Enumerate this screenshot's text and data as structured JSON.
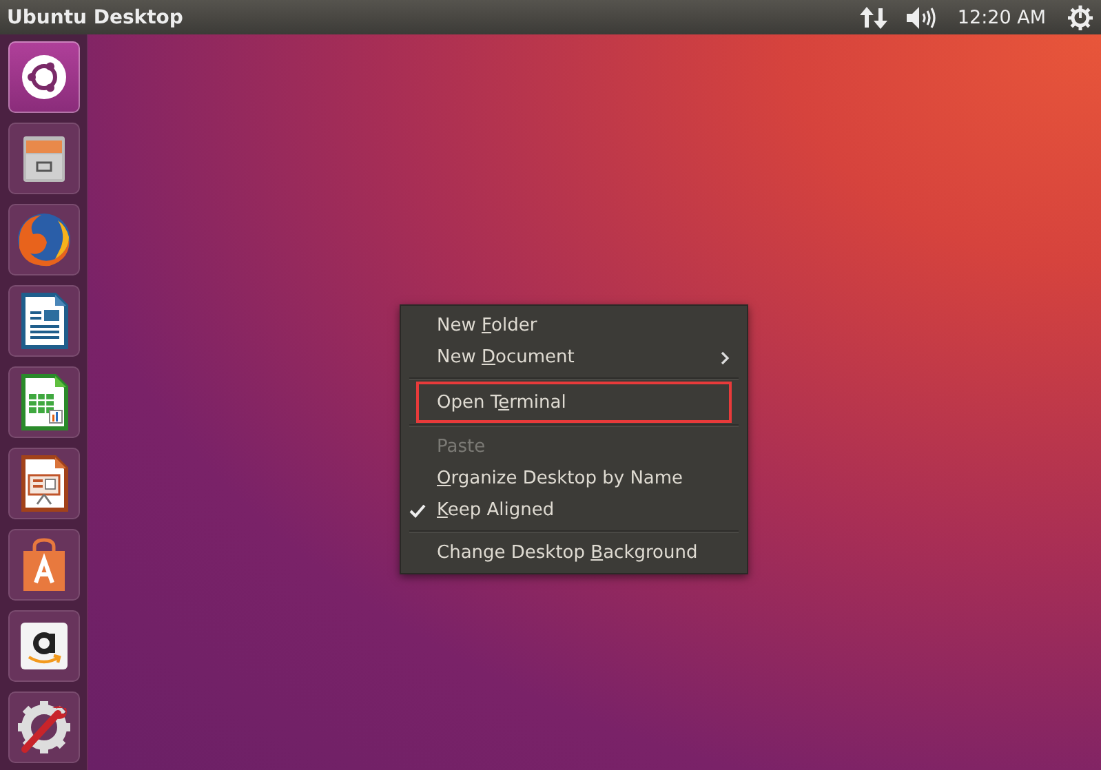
{
  "top_bar": {
    "title": "Ubuntu Desktop",
    "clock": "12:20 AM"
  },
  "launcher": [
    {
      "kind": "dash",
      "selected": true
    },
    {
      "kind": "files",
      "selected": false
    },
    {
      "kind": "browser",
      "selected": false
    },
    {
      "kind": "writer",
      "selected": false
    },
    {
      "kind": "calc",
      "selected": false
    },
    {
      "kind": "impress",
      "selected": false
    },
    {
      "kind": "store",
      "selected": false
    },
    {
      "kind": "amazon",
      "selected": false
    },
    {
      "kind": "settings",
      "selected": false
    }
  ],
  "context_menu": [
    {
      "kind": "item",
      "label": {
        "before": "New ",
        "key": "F",
        "after": "older"
      },
      "disabled": false,
      "checked": false,
      "submenu": false,
      "highlighted": false
    },
    {
      "kind": "item",
      "label": {
        "before": "New ",
        "key": "D",
        "after": "ocument"
      },
      "disabled": false,
      "checked": false,
      "submenu": true,
      "highlighted": false
    },
    {
      "kind": "separator"
    },
    {
      "kind": "item",
      "label": {
        "before": "Open T",
        "key": "e",
        "after": "rminal"
      },
      "disabled": false,
      "checked": false,
      "submenu": false,
      "highlighted": true
    },
    {
      "kind": "separator"
    },
    {
      "kind": "item",
      "label": {
        "before": "Paste"
      },
      "disabled": true,
      "checked": false,
      "submenu": false,
      "highlighted": false
    },
    {
      "kind": "item",
      "label": {
        "key": "O",
        "after": "rganize Desktop by Name"
      },
      "disabled": false,
      "checked": false,
      "submenu": false,
      "highlighted": false
    },
    {
      "kind": "item",
      "label": {
        "key": "K",
        "after": "eep Aligned"
      },
      "disabled": false,
      "checked": true,
      "submenu": false,
      "highlighted": false
    },
    {
      "kind": "separator"
    },
    {
      "kind": "item",
      "label": {
        "before": "Change Desktop ",
        "key": "B",
        "after": "ackground"
      },
      "disabled": false,
      "checked": false,
      "submenu": false,
      "highlighted": false
    }
  ]
}
